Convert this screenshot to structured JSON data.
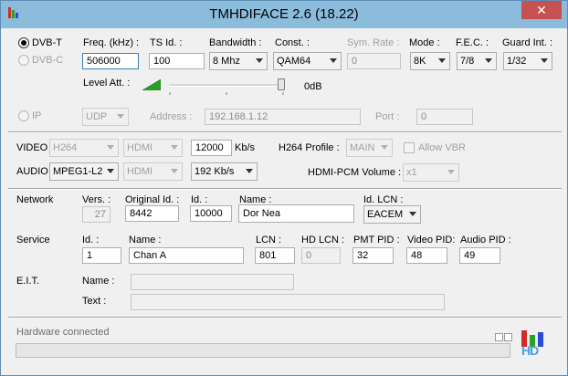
{
  "window": {
    "title": "TMHDIFACE 2.6 (18.22)",
    "close_glyph": "✕"
  },
  "tuner": {
    "dvbt_label": "DVB-T",
    "dvbc_label": "DVB-C",
    "freq_label": "Freq. (kHz) :",
    "freq_value": "506000",
    "tsid_label": "TS Id. :",
    "tsid_value": "100",
    "bandwidth_label": "Bandwidth :",
    "bandwidth_value": "8 Mhz",
    "const_label": "Const. :",
    "const_value": "QAM64",
    "symrate_label": "Sym. Rate :",
    "symrate_value": "0",
    "mode_label": "Mode :",
    "mode_value": "8K",
    "fec_label": "F.E.C. :",
    "fec_value": "7/8",
    "guard_label": "Guard Int. :",
    "guard_value": "1/32",
    "level_label": "Level Att. :",
    "level_value": "0dB"
  },
  "ip": {
    "ip_label": "IP",
    "protocol_value": "UDP",
    "address_label": "Address :",
    "address_value": "192.168.1.12",
    "port_label": "Port :",
    "port_value": "0"
  },
  "av": {
    "video_label": "VIDEO",
    "video_codec": "H264",
    "video_input": "HDMI",
    "video_bitrate": "12000",
    "video_unit": "Kb/s",
    "h264_profile_label": "H264 Profile :",
    "h264_profile_value": "MAIN",
    "allow_vbr_label": "Allow VBR",
    "audio_label": "AUDIO",
    "audio_codec": "MPEG1-L2",
    "audio_input": "HDMI",
    "audio_bitrate": "192 Kb/s",
    "hdmi_pcm_label": "HDMI-PCM Volume :",
    "hdmi_pcm_value": "x1"
  },
  "network": {
    "label": "Network",
    "vers_label": "Vers. :",
    "vers_value": "27",
    "orig_id_label": "Original Id. :",
    "orig_id_value": "8442",
    "id_label": "Id. :",
    "id_value": "10000",
    "name_label": "Name :",
    "name_value": "Dor Nea",
    "lcn_label": "Id. LCN :",
    "lcn_value": "EACEM"
  },
  "service": {
    "label": "Service",
    "id_label": "Id. :",
    "id_value": "1",
    "name_label": "Name :",
    "name_value": "Chan A",
    "lcn_label": "LCN :",
    "lcn_value": "801",
    "hdlcn_label": "HD LCN :",
    "hdlcn_value": "0",
    "pmt_label": "PMT PID :",
    "pmt_value": "32",
    "video_pid_label": "Video PID:",
    "video_pid_value": "48",
    "audio_pid_label": "Audio PID :",
    "audio_pid_value": "49"
  },
  "eit": {
    "label": "E.I.T.",
    "name_label": "Name :",
    "name_value": "",
    "text_label": "Text :",
    "text_value": ""
  },
  "status": {
    "text": "Hardware connected",
    "progress": 0,
    "logo_text": "HD"
  },
  "colors": {
    "titlebar": "#8bbcdc",
    "close": "#c75050",
    "logo_red": "#d42a2a",
    "logo_green": "#2aa02a",
    "logo_blue": "#2a4ad4"
  }
}
